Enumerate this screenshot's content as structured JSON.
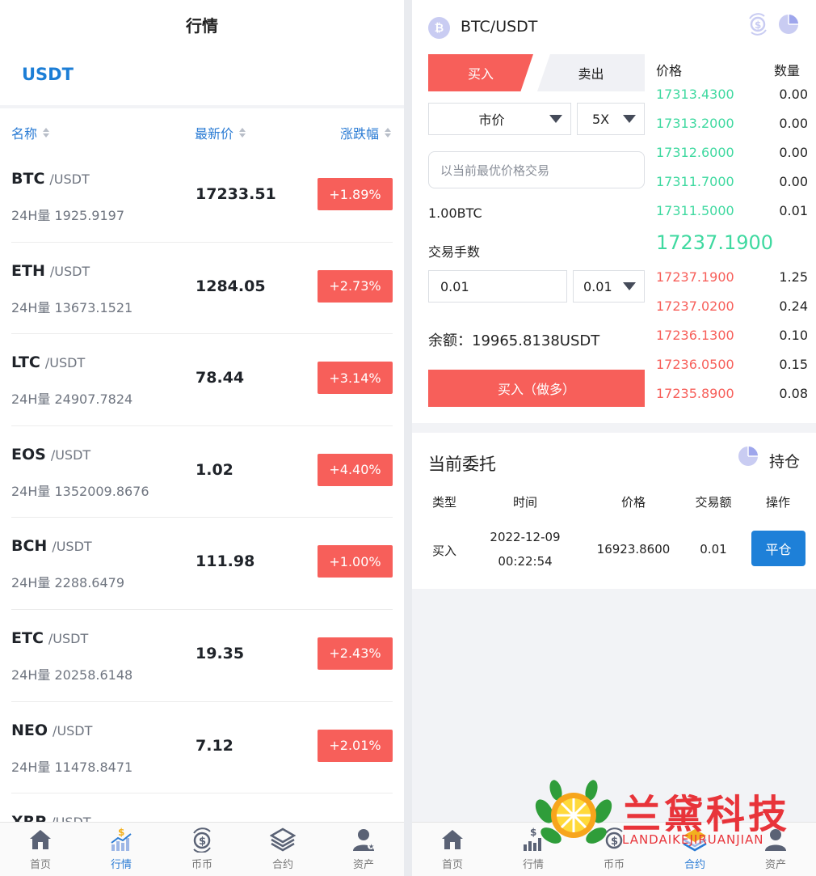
{
  "left": {
    "title": "行情",
    "tab": "USDT",
    "headers": {
      "name": "名称",
      "price": "最新价",
      "change": "涨跌幅"
    },
    "rows": [
      {
        "symbol": "BTC",
        "quote": "/USDT",
        "volume": "24H量 1925.9197",
        "price": "17233.51",
        "change": "+1.89%"
      },
      {
        "symbol": "ETH",
        "quote": "/USDT",
        "volume": "24H量 13673.1521",
        "price": "1284.05",
        "change": "+2.73%"
      },
      {
        "symbol": "LTC",
        "quote": "/USDT",
        "volume": "24H量 24907.7824",
        "price": "78.44",
        "change": "+3.14%"
      },
      {
        "symbol": "EOS",
        "quote": "/USDT",
        "volume": "24H量 1352009.8676",
        "price": "1.02",
        "change": "+4.40%"
      },
      {
        "symbol": "BCH",
        "quote": "/USDT",
        "volume": "24H量 2288.6479",
        "price": "111.98",
        "change": "+1.00%"
      },
      {
        "symbol": "ETC",
        "quote": "/USDT",
        "volume": "24H量 20258.6148",
        "price": "19.35",
        "change": "+2.43%"
      },
      {
        "symbol": "NEO",
        "quote": "/USDT",
        "volume": "24H量 11478.8471",
        "price": "7.12",
        "change": "+2.01%"
      },
      {
        "symbol": "XRP",
        "quote": "/USDT",
        "volume": "",
        "price": "",
        "change": ""
      }
    ],
    "tabbar": [
      {
        "label": "首页",
        "icon": "home-icon"
      },
      {
        "label": "行情",
        "icon": "chart-icon"
      },
      {
        "label": "币币",
        "icon": "coin-exchange-icon"
      },
      {
        "label": "合约",
        "icon": "layers-icon"
      },
      {
        "label": "资产",
        "icon": "user-icon"
      }
    ]
  },
  "right": {
    "coin_glyph": "₿",
    "pair": "BTC/USDT",
    "buy_tab": "买入",
    "sell_tab": "卖出",
    "order_type": "市价",
    "leverage": "5X",
    "price_placeholder": "以当前最优价格交易",
    "amount_btc": "1.00BTC",
    "lots_label": "交易手数",
    "lots_value": "0.01",
    "lots_step": "0.01",
    "balance": "余额：19965.8138USDT",
    "buy_button": "买入（做多）",
    "orderbook": {
      "price_header": "价格",
      "qty_header": "数量",
      "asks": [
        {
          "price": "17313.4300",
          "qty": "0.00"
        },
        {
          "price": "17313.2000",
          "qty": "0.00"
        },
        {
          "price": "17312.6000",
          "qty": "0.00"
        },
        {
          "price": "17311.7000",
          "qty": "0.00"
        },
        {
          "price": "17311.5000",
          "qty": "0.01"
        }
      ],
      "last_price": "17237.1900",
      "bids": [
        {
          "price": "17237.1900",
          "qty": "1.25"
        },
        {
          "price": "17237.0200",
          "qty": "0.24"
        },
        {
          "price": "17236.1300",
          "qty": "0.10"
        },
        {
          "price": "17236.0500",
          "qty": "0.15"
        },
        {
          "price": "17235.8900",
          "qty": "0.08"
        }
      ]
    },
    "orders": {
      "title": "当前委托",
      "hold_label": "持仓",
      "headers": {
        "type": "类型",
        "time": "时间",
        "price": "价格",
        "amount": "交易额",
        "action": "操作"
      },
      "row": {
        "type": "买入",
        "date": "2022-12-09",
        "time": "00:22:54",
        "price": "16923.8600",
        "amount": "0.01",
        "action": "平仓"
      }
    },
    "tabbar": [
      {
        "label": "首页",
        "icon": "home-icon"
      },
      {
        "label": "行情",
        "icon": "chart-icon"
      },
      {
        "label": "币币",
        "icon": "coin-exchange-icon"
      },
      {
        "label": "合约",
        "icon": "layers-icon"
      },
      {
        "label": "资产",
        "icon": "user-icon"
      }
    ]
  },
  "watermark": {
    "title": "兰黛科技",
    "subtitle": "LANDAIKEJIRUANJIAN"
  },
  "colors": {
    "accent_blue": "#2a7bd4",
    "buy_red": "#f75f5a",
    "ask_green": "#3fd9a0",
    "button_blue": "#1e80d8"
  }
}
